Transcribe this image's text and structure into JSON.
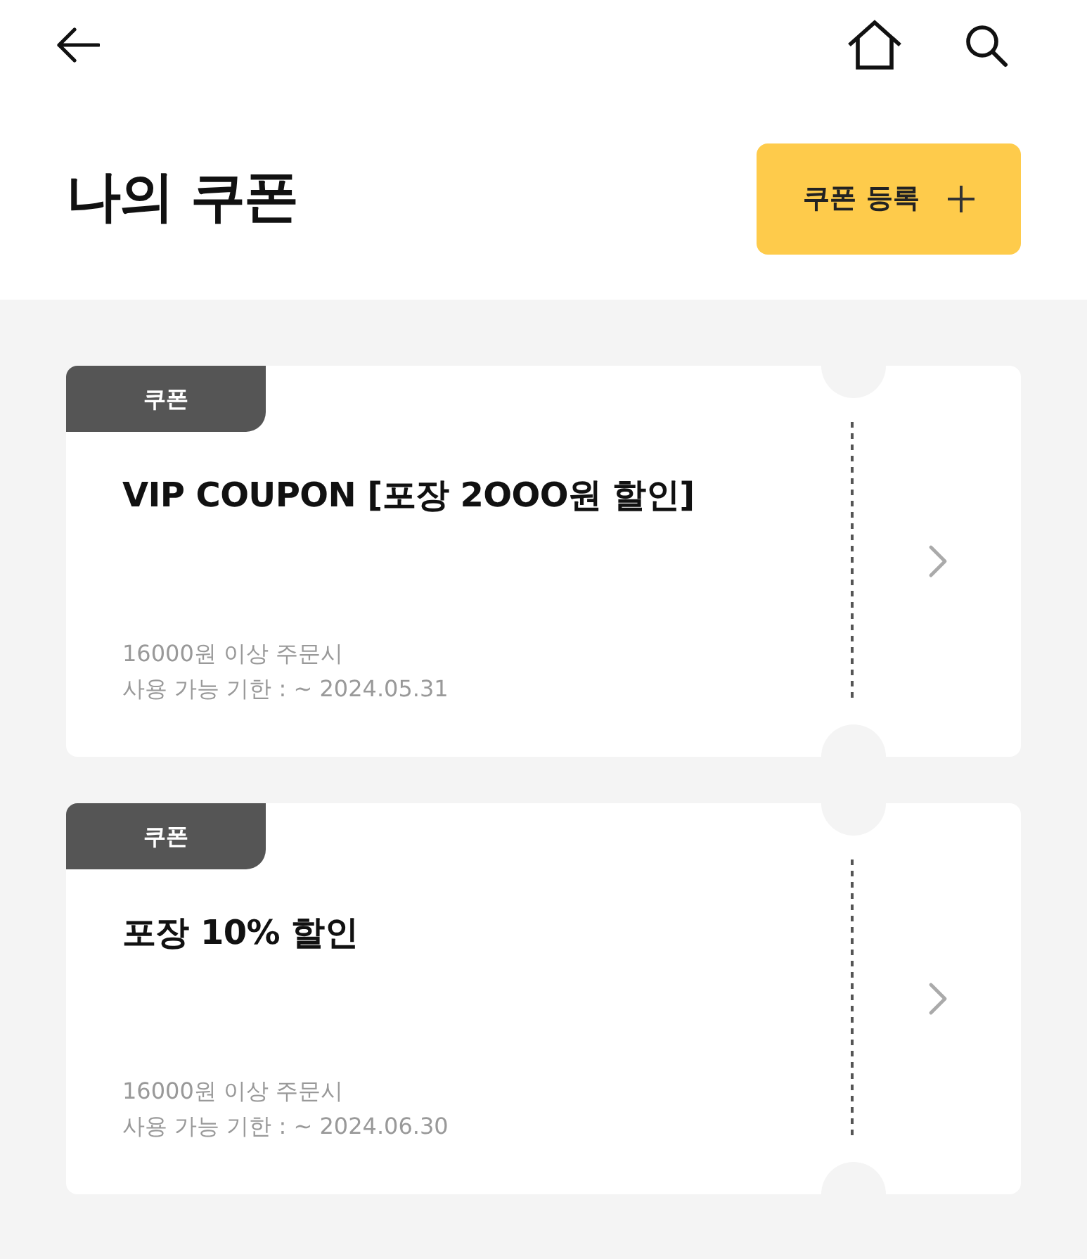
{
  "header": {
    "title": "나의 쿠폰",
    "register_button": {
      "label": "쿠폰 등록"
    }
  },
  "coupons": [
    {
      "tag": "쿠폰",
      "title": "VIP COUPON [포장 2OOO원 할인]",
      "condition": "16000원 이상 주문시",
      "expiry": "사용 가능 기한 : ~ 2024.05.31"
    },
    {
      "tag": "쿠폰",
      "title": "포장 10% 할인",
      "condition": "16000원 이상 주문시",
      "expiry": "사용 가능 기한 : ~ 2024.06.30"
    }
  ]
}
